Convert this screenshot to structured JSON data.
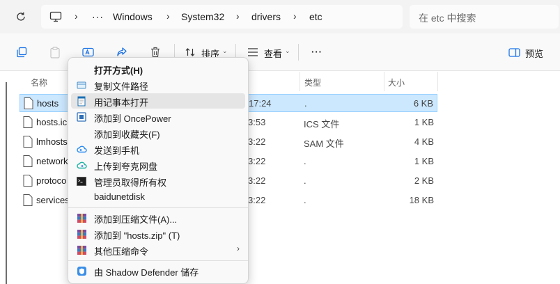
{
  "address": {
    "ellipsis": "···",
    "crumbs": [
      "Windows",
      "System32",
      "drivers",
      "etc"
    ],
    "search_placeholder": "在 etc 中搜索"
  },
  "toolbar": {
    "sort_label": "排序",
    "view_label": "查看",
    "more_label": "···",
    "preview_label": "预览"
  },
  "columns": {
    "name": "名称",
    "type": "类型",
    "size": "大小"
  },
  "files": [
    {
      "name": "hosts",
      "date": "17:24",
      "type": ".",
      "size": "6 KB"
    },
    {
      "name": "hosts.ic",
      "date": "3:53",
      "type": "ICS 文件",
      "size": "1 KB"
    },
    {
      "name": "lmhosts",
      "date": "3:22",
      "type": "SAM 文件",
      "size": "4 KB"
    },
    {
      "name": "network",
      "date": "3:22",
      "type": ".",
      "size": "1 KB"
    },
    {
      "name": "protoco",
      "date": "3:22",
      "type": ".",
      "size": "2 KB"
    },
    {
      "name": "services",
      "date": "3:22",
      "type": ".",
      "size": "18 KB"
    }
  ],
  "context_menu": {
    "items": [
      {
        "label": "打开方式(H)",
        "icon": "none",
        "bold": true
      },
      {
        "label": "复制文件路径",
        "icon": "path-icon"
      },
      {
        "label": "用记事本打开",
        "icon": "notepad-icon"
      },
      {
        "label": "添加到 OncePower",
        "icon": "oncepower-icon"
      },
      {
        "label": "添加到收藏夹(F)",
        "icon": "none"
      },
      {
        "label": "发送到手机",
        "icon": "baidu-cloud-icon"
      },
      {
        "label": "上传到夸克网盘",
        "icon": "quark-cloud-icon"
      },
      {
        "label": "管理员取得所有权",
        "icon": "cmd-icon"
      },
      {
        "label": "baidunetdisk",
        "icon": "none"
      },
      {
        "label": "添加到压缩文件(A)...",
        "icon": "winrar-icon"
      },
      {
        "label": "添加到 \"hosts.zip\" (T)",
        "icon": "winrar-icon"
      },
      {
        "label": "其他压缩命令",
        "icon": "winrar-icon",
        "submenu": true
      },
      {
        "label": "由 Shadow Defender 储存",
        "icon": "shadow-defender-icon"
      }
    ]
  },
  "colors": {
    "selection": "#cce8ff",
    "selection_border": "#99d1ff",
    "menu_bg": "#f9f9f9",
    "accent_blue": "#1a73e8"
  }
}
